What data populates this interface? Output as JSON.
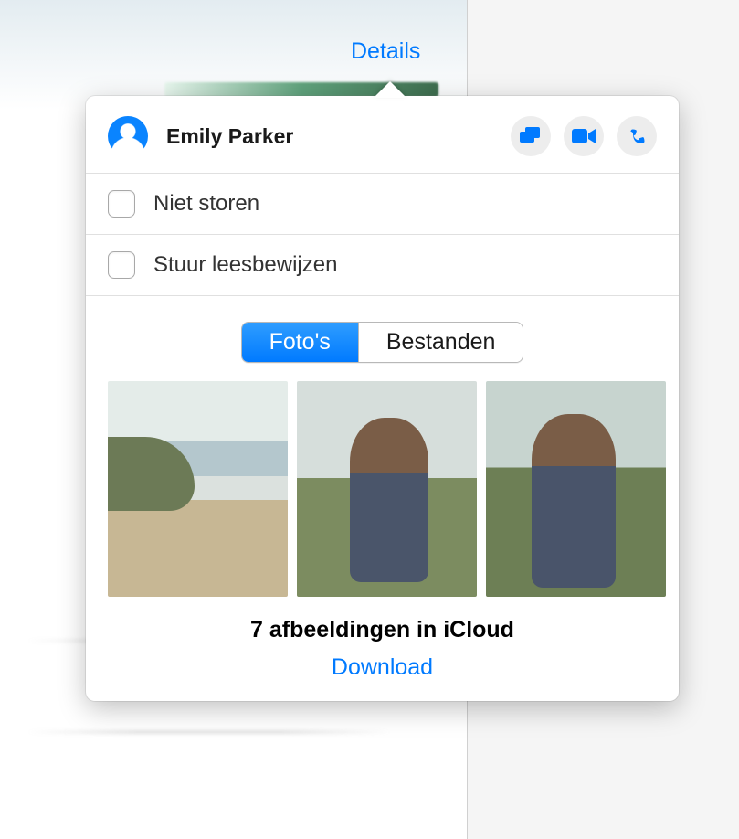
{
  "trigger": {
    "details_label": "Details"
  },
  "header": {
    "contact_name": "Emily Parker",
    "actions": {
      "screen_share": "screen-share-icon",
      "video_call": "video-icon",
      "audio_call": "phone-icon"
    }
  },
  "options": [
    {
      "key": "dnd",
      "label": "Niet storen",
      "checked": false
    },
    {
      "key": "read_receipts",
      "label": "Stuur leesbewijzen",
      "checked": false
    }
  ],
  "tabs": {
    "photos": "Foto's",
    "files": "Bestanden",
    "active": "photos"
  },
  "photos_count": 3,
  "icloud": {
    "status_text": "7 afbeeldingen in iCloud",
    "download_label": "Download"
  },
  "colors": {
    "accent": "#007aff"
  }
}
